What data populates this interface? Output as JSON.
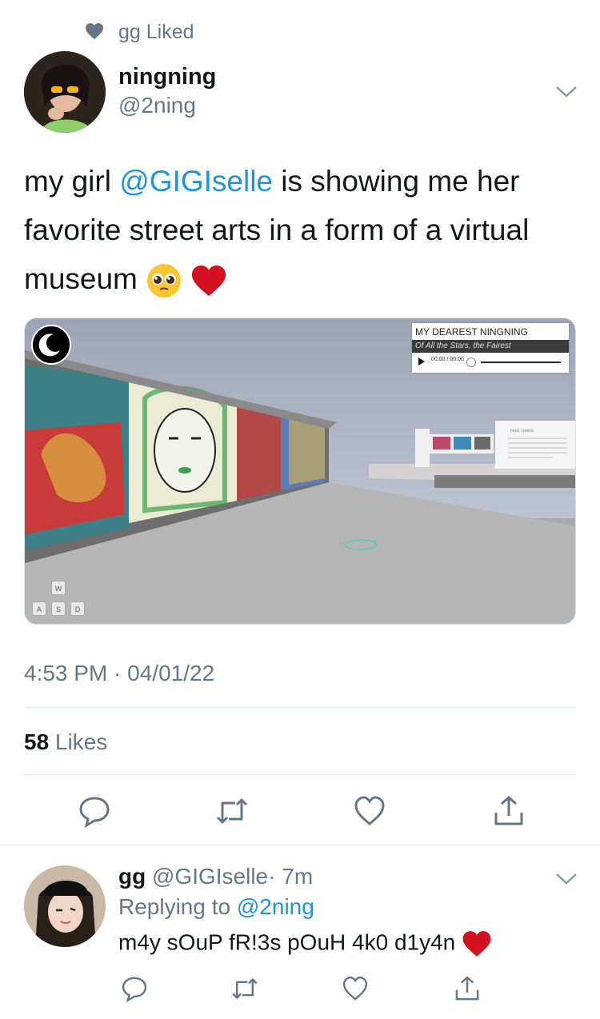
{
  "context": {
    "text": "gg Liked",
    "icon": "heart-icon"
  },
  "tweet": {
    "name": "ningning",
    "handle": "@2ning",
    "text_before": "my girl ",
    "mention": "@GIGIselle",
    "text_after": " is showing me her favorite street arts in a form of a virtual museum ",
    "emojis": [
      "pleading-face-emoji",
      "red-heart-emoji"
    ],
    "timestamp": "4:53 PM · 04/01/22",
    "likes_count": "58",
    "likes_label": " Likes"
  },
  "media": {
    "music_title": "MY DEAREST NINGNING",
    "music_subtitle": "Of All the Stars, the Fairest",
    "music_time": "00:00 / 00:00",
    "keys": {
      "w": "W",
      "a": "A",
      "s": "S",
      "d": "D"
    },
    "sign_text": "TAKE THREE"
  },
  "actions": [
    "reply-icon",
    "retweet-icon",
    "like-icon",
    "share-icon"
  ],
  "reply": {
    "name": "gg",
    "handle": "@GIGIselle",
    "time": "· 7m",
    "replying_label": "Replying to ",
    "replying_to": "@2ning",
    "text": "m4y sOuP fR!3s pOuH 4k0 d1y4n "
  },
  "colors": {
    "link": "#1b95e0",
    "muted": "#657786",
    "heart": "#d4121f"
  }
}
